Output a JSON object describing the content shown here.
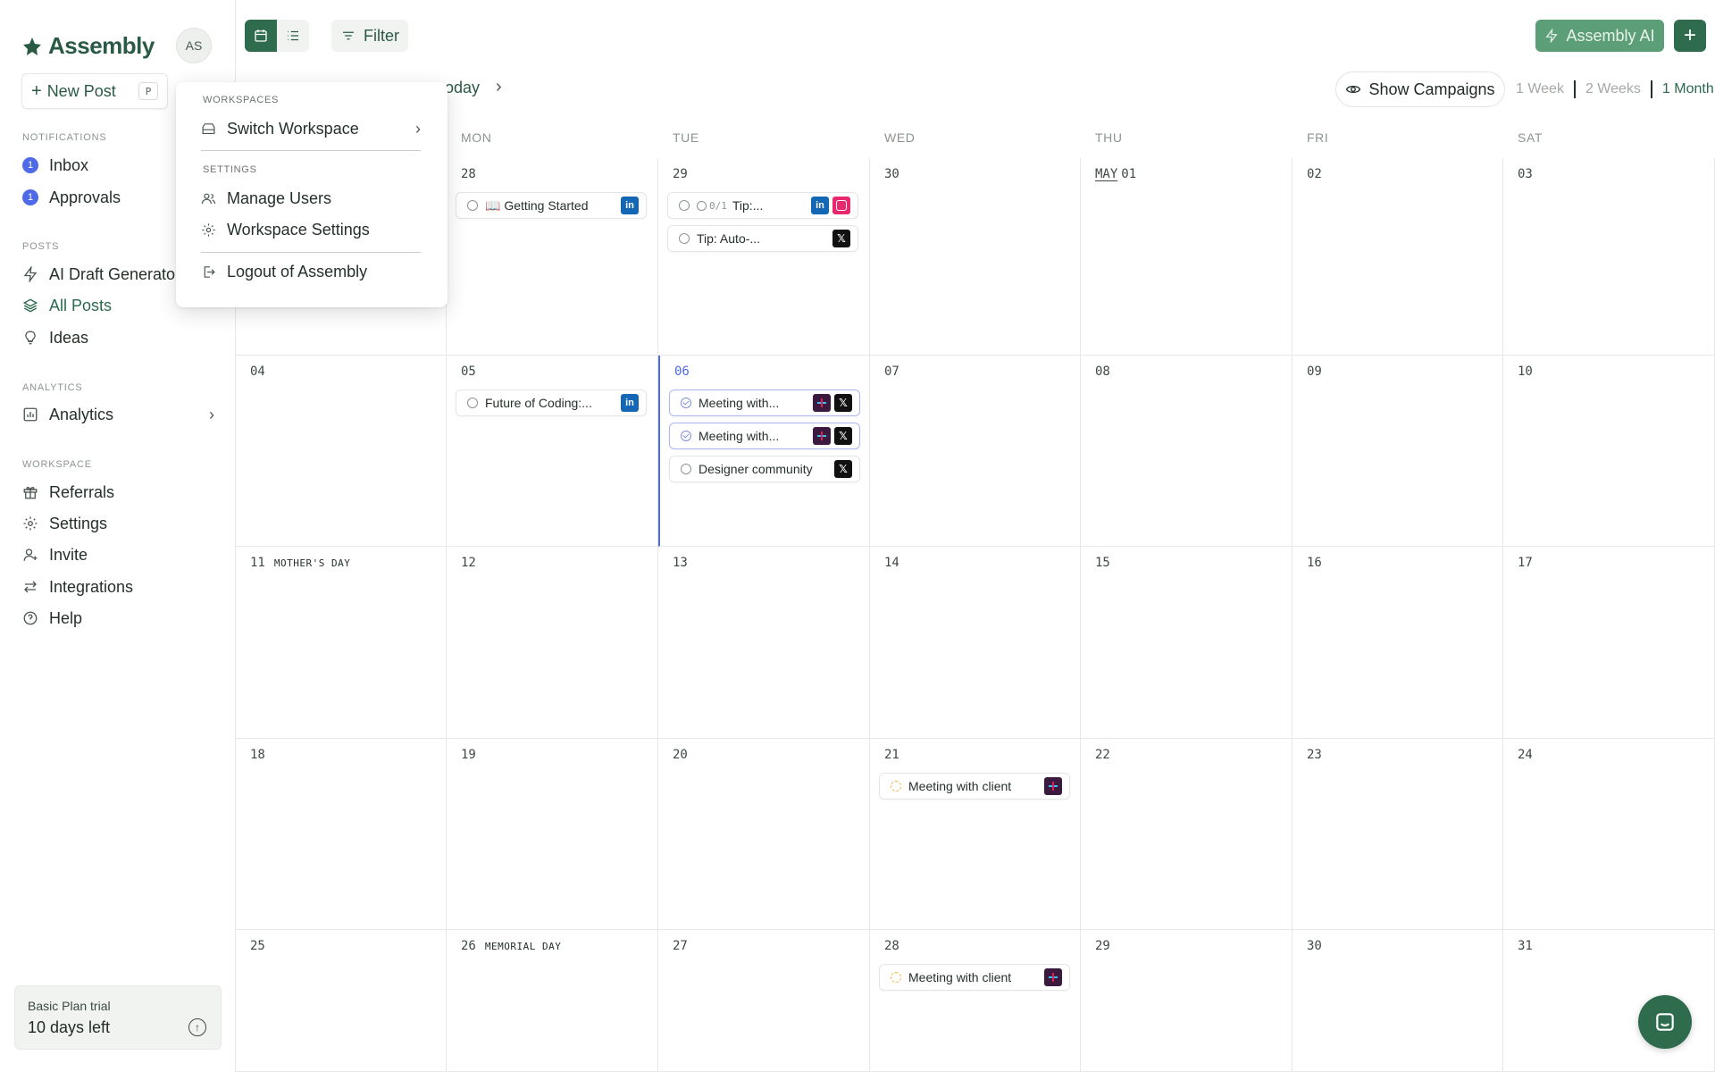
{
  "app": {
    "name": "Assembly",
    "avatar_initials": "AS"
  },
  "sidebar": {
    "new_post_label": "New Post",
    "new_post_shortcut": "P",
    "sections": {
      "notifications": "NOTIFICATIONS",
      "posts": "POSTS",
      "analytics": "ANALYTICS",
      "workspace": "WORKSPACE"
    },
    "inbox": {
      "label": "Inbox",
      "count": "1"
    },
    "approvals": {
      "label": "Approvals",
      "count": "1"
    },
    "ai_draft": "AI Draft Generator",
    "all_posts": "All Posts",
    "ideas": "Ideas",
    "analytics": "Analytics",
    "referrals": "Referrals",
    "settings": "Settings",
    "invite": "Invite",
    "integrations": "Integrations",
    "help": "Help",
    "trial": {
      "title": "Basic Plan trial",
      "days": "10 days left"
    }
  },
  "toolbar": {
    "filter_label": "Filter",
    "ai_label": "Assembly AI",
    "add_label": "+",
    "today_label": "oday",
    "show_campaigns": "Show Campaigns",
    "ranges": [
      "1 Week",
      "2 Weeks",
      "1 Month"
    ],
    "active_range": "1 Month"
  },
  "menu": {
    "workspaces_label": "WORKSPACES",
    "switch_workspace": "Switch Workspace",
    "settings_label": "SETTINGS",
    "manage_users": "Manage Users",
    "workspace_settings": "Workspace Settings",
    "logout": "Logout of Assembly"
  },
  "calendar": {
    "weekdays": [
      "",
      "MON",
      "TUE",
      "WED",
      "THU",
      "FRI",
      "SAT"
    ],
    "weeks": [
      [
        {
          "day": ""
        },
        {
          "day": "28",
          "posts": [
            {
              "title": "📖 Getting Started",
              "status": "draft",
              "platforms": [
                "li"
              ]
            }
          ]
        },
        {
          "day": "29",
          "posts": [
            {
              "title": "Tip:...",
              "status": "draft",
              "approval": "0/1",
              "platforms": [
                "li",
                "ig"
              ]
            },
            {
              "title": "Tip: Auto-...",
              "status": "draft",
              "platforms": [
                "x"
              ]
            }
          ]
        },
        {
          "day": "30"
        },
        {
          "day": "01",
          "month": "MAY"
        },
        {
          "day": "02"
        },
        {
          "day": "03"
        }
      ],
      [
        {
          "day": "04"
        },
        {
          "day": "05",
          "posts": [
            {
              "title": "Future of Coding:...",
              "status": "draft",
              "platforms": [
                "li"
              ]
            }
          ]
        },
        {
          "day": "06",
          "today": true,
          "posts": [
            {
              "title": "Meeting with...",
              "status": "scheduled",
              "selected": true,
              "platforms": [
                "sl",
                "x"
              ]
            },
            {
              "title": "Meeting with...",
              "status": "scheduled",
              "selected": true,
              "platforms": [
                "sl",
                "x"
              ]
            },
            {
              "title": "Designer community",
              "status": "draft",
              "platforms": [
                "x"
              ]
            }
          ]
        },
        {
          "day": "07"
        },
        {
          "day": "08"
        },
        {
          "day": "09"
        },
        {
          "day": "10"
        }
      ],
      [
        {
          "day": "11",
          "holiday": "MOTHER'S DAY"
        },
        {
          "day": "12"
        },
        {
          "day": "13"
        },
        {
          "day": "14"
        },
        {
          "day": "15"
        },
        {
          "day": "16"
        },
        {
          "day": "17"
        }
      ],
      [
        {
          "day": "18"
        },
        {
          "day": "19"
        },
        {
          "day": "20"
        },
        {
          "day": "21",
          "posts": [
            {
              "title": "Meeting with client",
              "status": "pending",
              "platforms": [
                "sl"
              ]
            }
          ]
        },
        {
          "day": "22"
        },
        {
          "day": "23"
        },
        {
          "day": "24"
        }
      ],
      [
        {
          "day": "25"
        },
        {
          "day": "26",
          "holiday": "MEMORIAL DAY"
        },
        {
          "day": "27"
        },
        {
          "day": "28",
          "posts": [
            {
              "title": "Meeting with client",
              "status": "pending",
              "platforms": [
                "sl"
              ]
            }
          ]
        },
        {
          "day": "29"
        },
        {
          "day": "30"
        },
        {
          "day": "31"
        }
      ]
    ]
  },
  "colors": {
    "brand": "#2f6b4d",
    "accent_blue": "#4f6ae8",
    "linkedin": "#1467b5",
    "instagram": "#e8296d",
    "x": "#111111",
    "slack": "#3c1a3f"
  }
}
